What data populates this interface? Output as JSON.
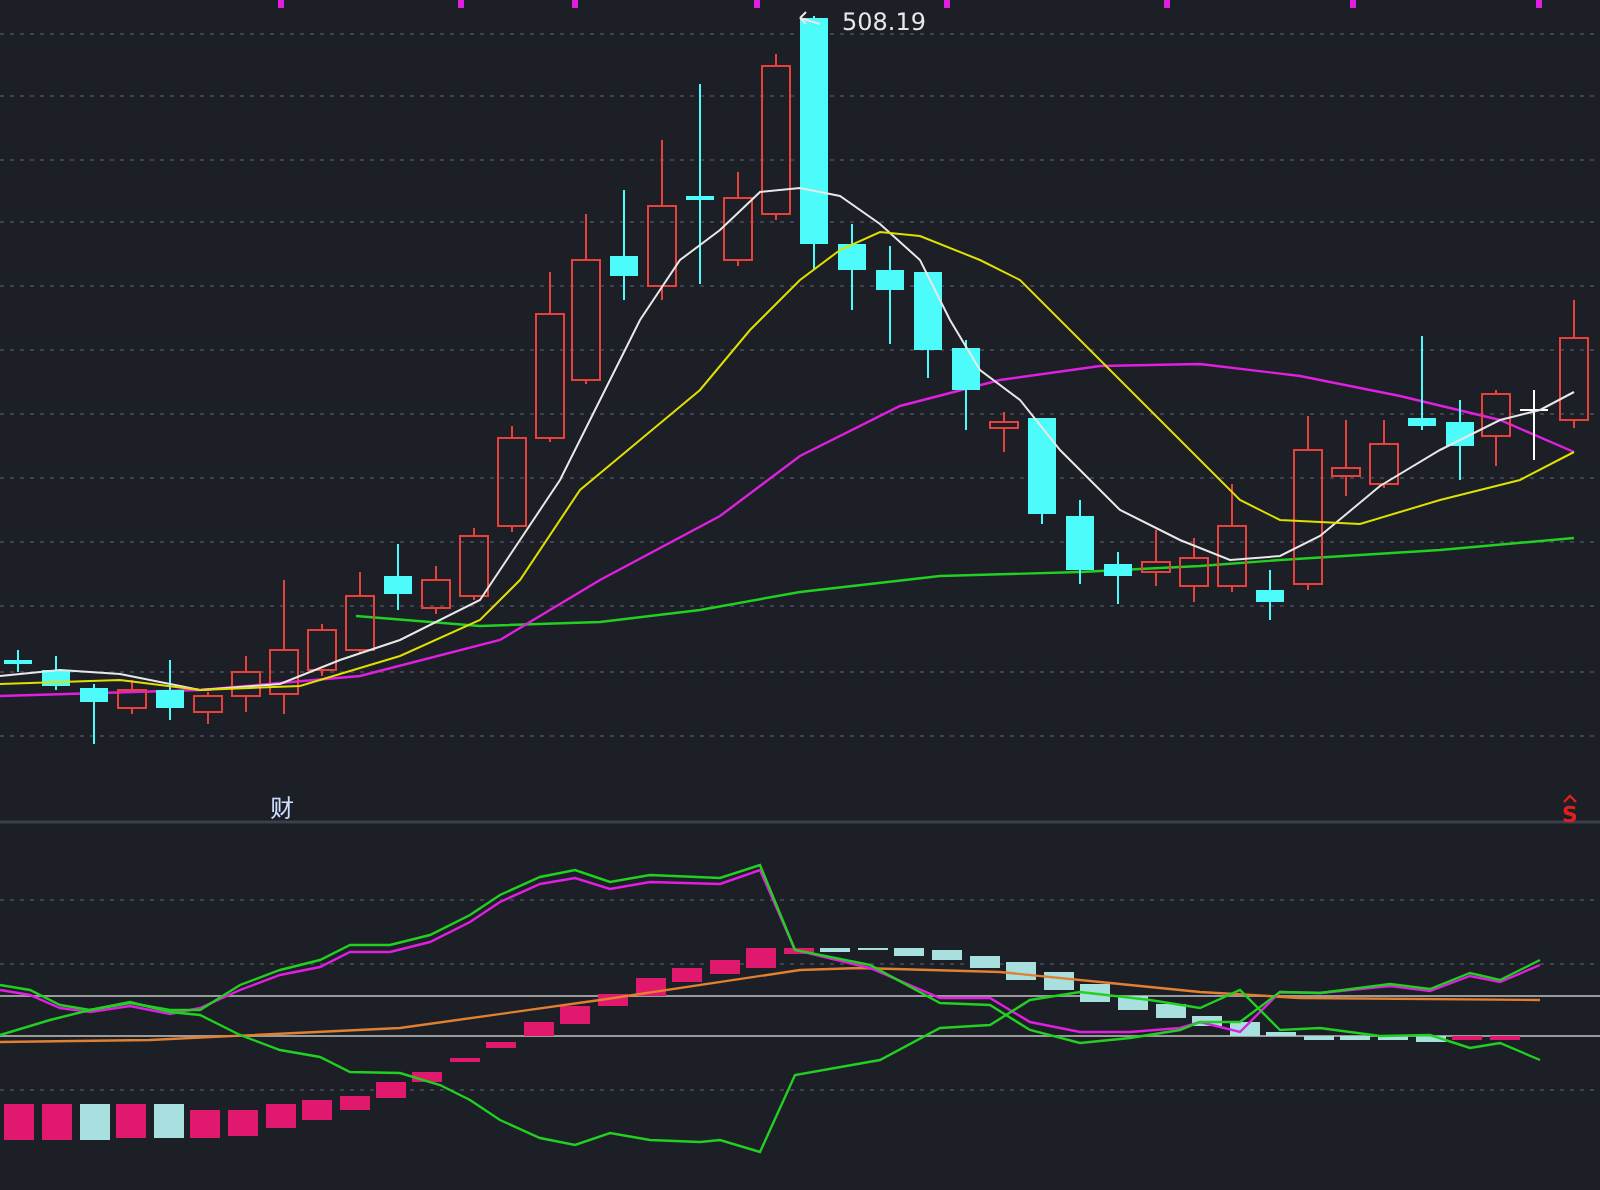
{
  "price_panel": {
    "peak_label": "508.19"
  },
  "indicator_panel": {
    "marker": "财",
    "signal_marker": "S"
  }
}
